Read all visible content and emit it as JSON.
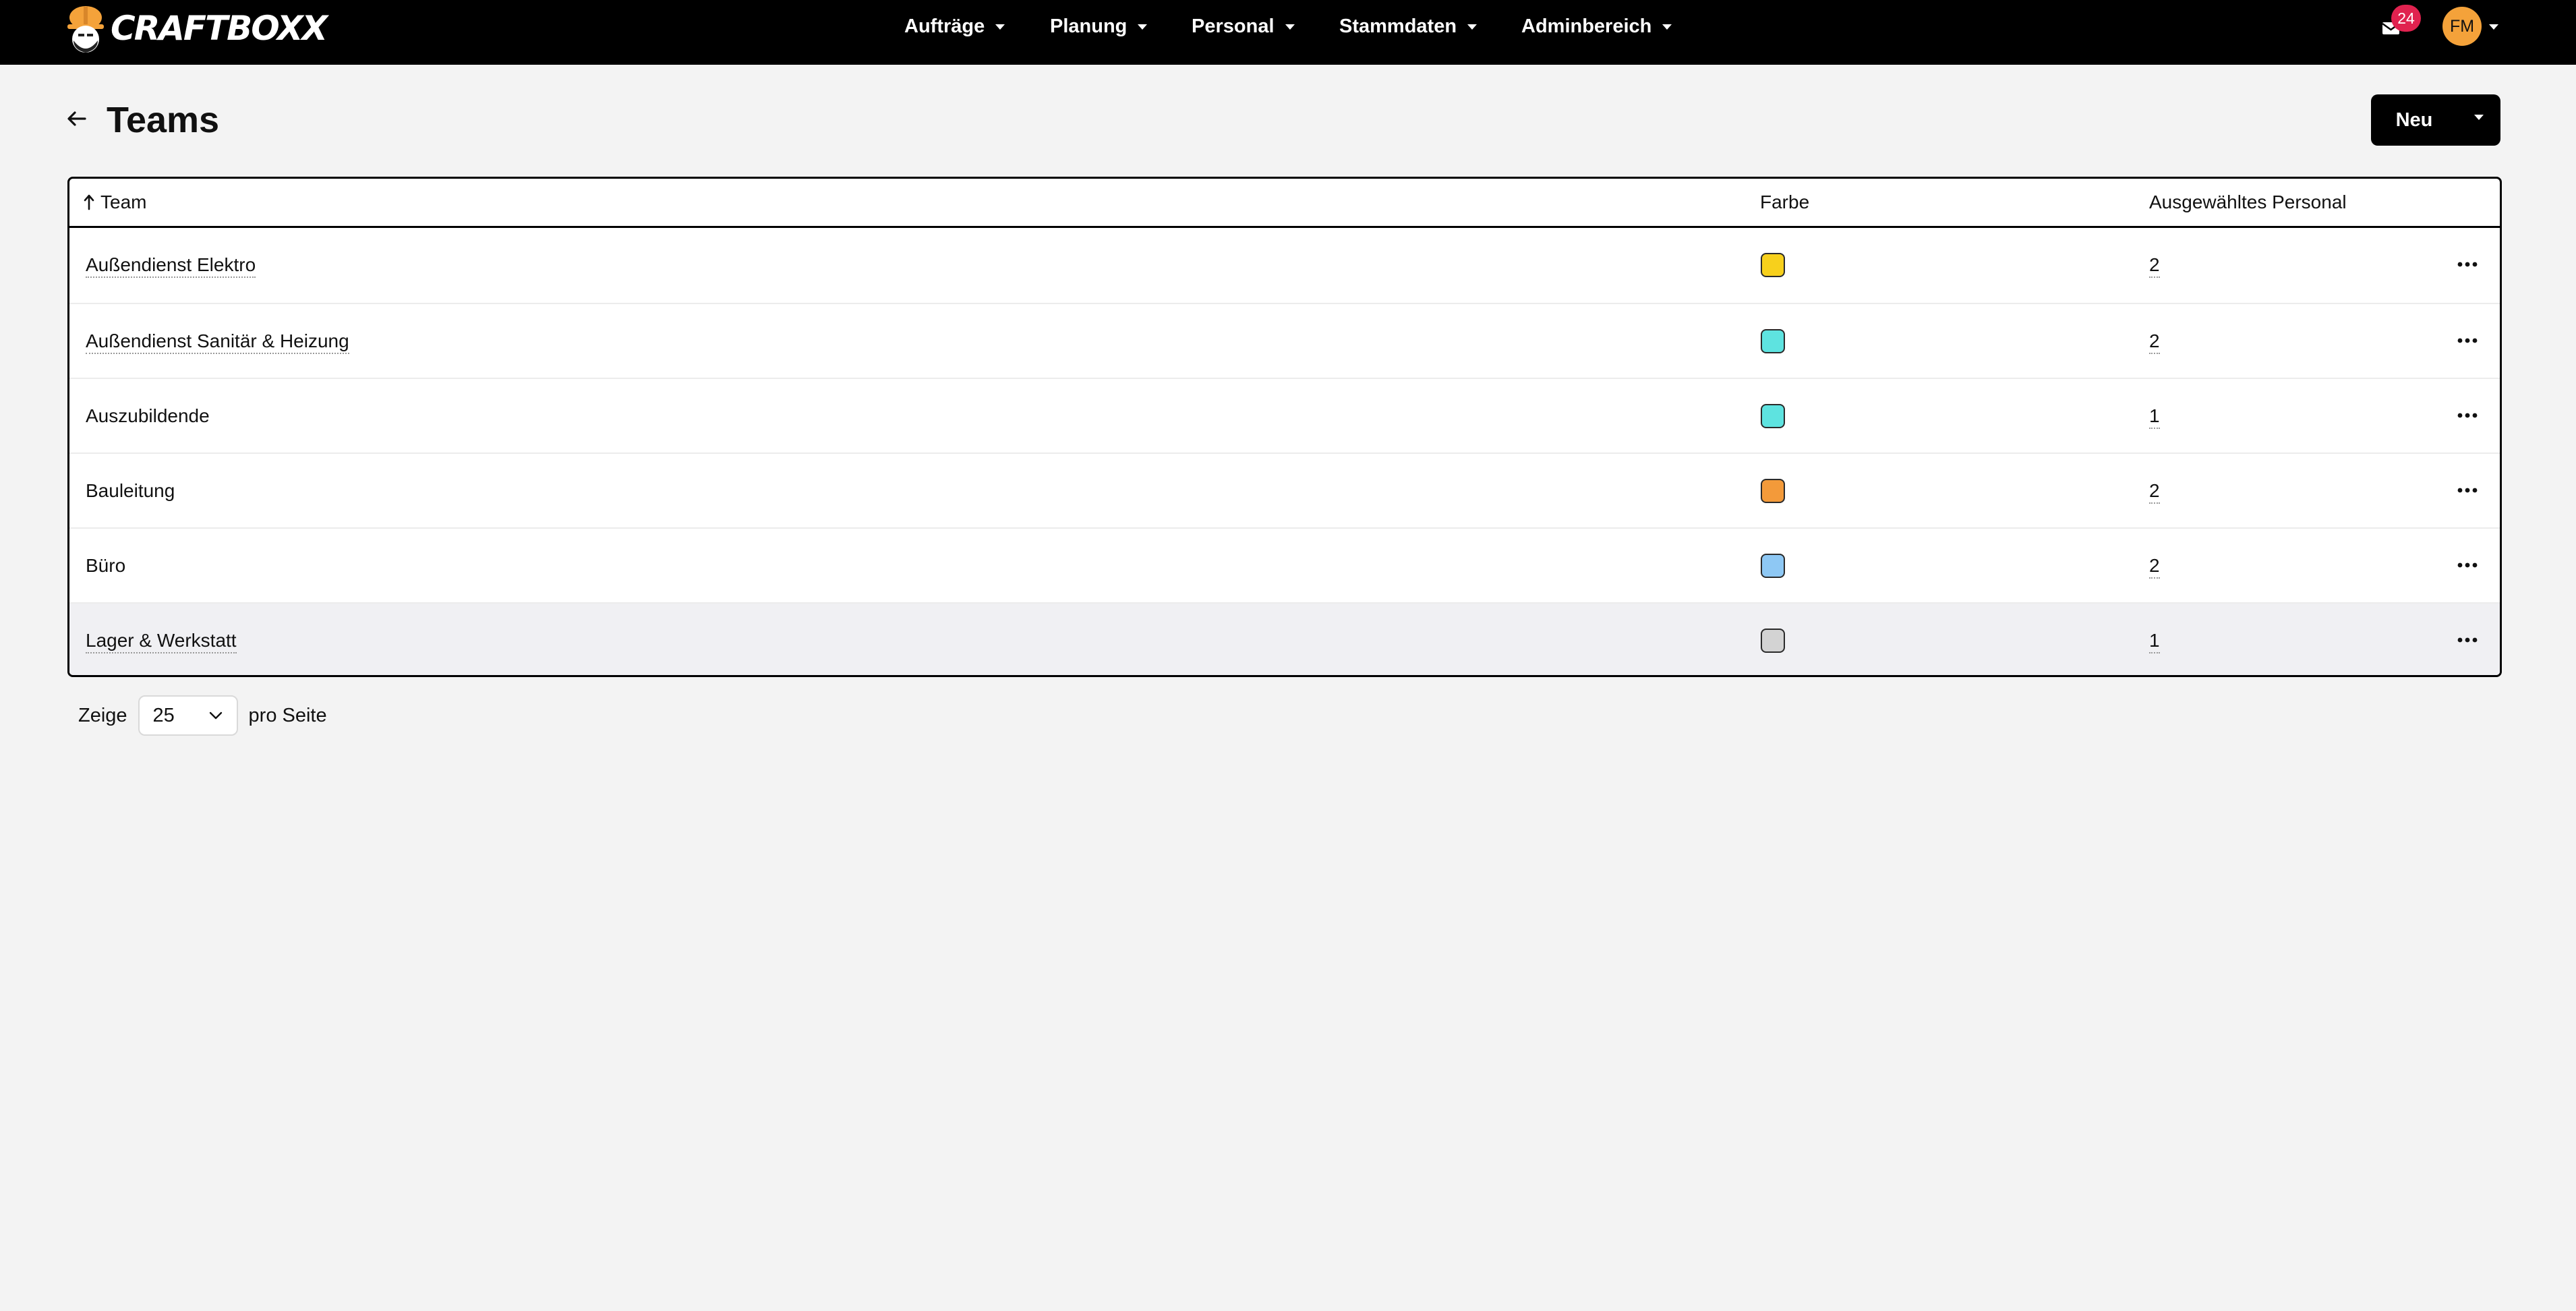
{
  "navbar": {
    "brand": "CRAFTBOXX",
    "menu": [
      {
        "label": "Aufträge",
        "name": "nav-auftraege"
      },
      {
        "label": "Planung",
        "name": "nav-planung"
      },
      {
        "label": "Personal",
        "name": "nav-personal"
      },
      {
        "label": "Stammdaten",
        "name": "nav-stammdaten"
      },
      {
        "label": "Adminbereich",
        "name": "nav-adminbereich"
      }
    ],
    "mail_icon": "envelope-icon",
    "mail_count": "24",
    "avatar_initials": "FM",
    "avatar_color": "#f4a23a"
  },
  "header": {
    "back_icon": "arrow-left-icon",
    "title": "Teams",
    "new_button_label": "Neu",
    "new_button_toggle_icon": "caret-down-icon"
  },
  "table": {
    "columns": {
      "team": "Team",
      "farbe": "Farbe",
      "personal": "Ausgewähltes Personal"
    },
    "sort": {
      "column": "team",
      "direction": "ascending",
      "icon": "arrow-up-icon"
    },
    "row_menu_icon": "ellipsis-icon",
    "rows": [
      {
        "team": "Außendienst Elektro",
        "color": "#f7d01c",
        "count": "2",
        "underlined": true
      },
      {
        "team": "Außendienst Sanitär & Heizung",
        "color": "#5ee3e0",
        "count": "2",
        "underlined": true
      },
      {
        "team": "Auszubildende",
        "color": "#5ee3e0",
        "count": "1",
        "underlined": false
      },
      {
        "team": "Bauleitung",
        "color": "#f39a3a",
        "count": "2",
        "underlined": false
      },
      {
        "team": "Büro",
        "color": "#8ec8f4",
        "count": "2",
        "underlined": false
      },
      {
        "team": "Lager & Werkstatt",
        "color": "#d3d3d3",
        "count": "1",
        "underlined": true
      }
    ]
  },
  "pagination": {
    "prefix": "Zeige",
    "per_page": "25",
    "suffix": "pro Seite"
  }
}
